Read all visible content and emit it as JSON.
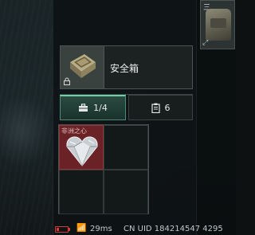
{
  "case": {
    "name": "安全箱"
  },
  "tabs": [
    {
      "count": "1/4",
      "icon": "toolbox-icon"
    },
    {
      "count": "6",
      "icon": "clipboard-icon"
    }
  ],
  "grid": {
    "items": [
      {
        "label": "非洲之心",
        "icon": "heart-diamond-icon",
        "rarity_color": "#6a2227"
      }
    ]
  },
  "status_bar": {
    "ping": "29ms",
    "uid": "CN UID 184214547 4295"
  },
  "colors": {
    "accent": "#6fd0a8",
    "battery": "#d33a3a"
  }
}
